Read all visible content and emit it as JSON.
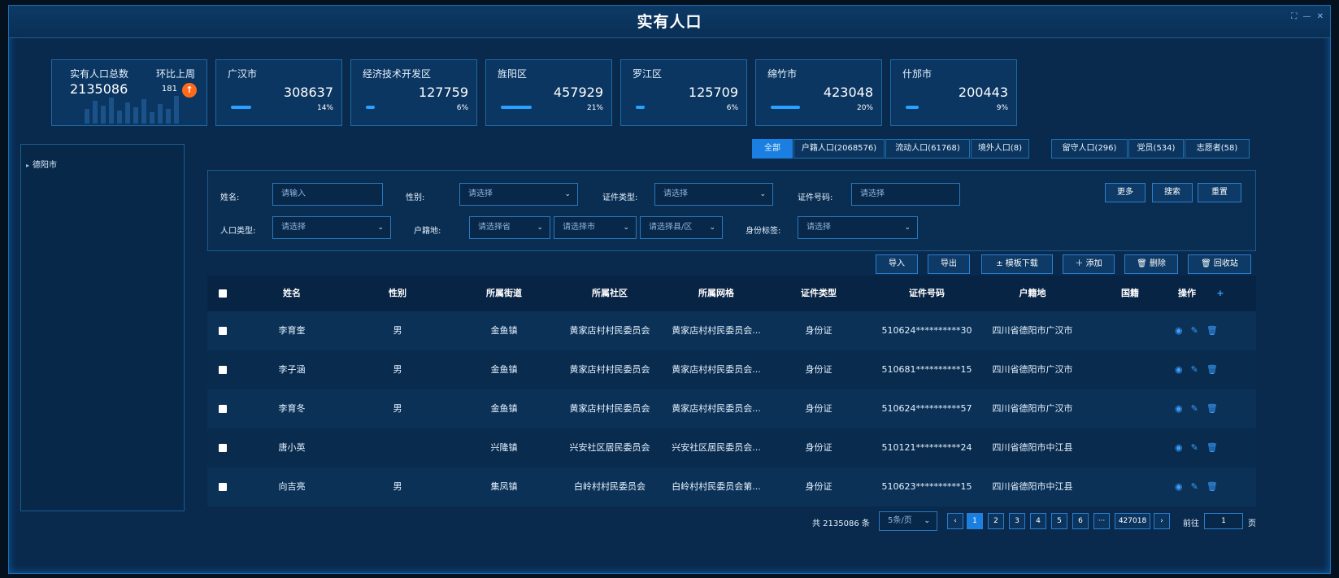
{
  "window": {
    "title": "实有人口",
    "controls": "⛶ — ✕"
  },
  "total": {
    "label": "实有人口总数",
    "ratio_label": "环比上周",
    "value": "2135086",
    "ratio_value": "181",
    "ratio_icon": "arrow-up-icon"
  },
  "regions": [
    {
      "name": "广汉市",
      "value": "308637",
      "pct": "14%",
      "fill": 0.14
    },
    {
      "name": "经济技术开发区",
      "value": "127759",
      "pct": "6%",
      "fill": 0.06
    },
    {
      "name": "旌阳区",
      "value": "457929",
      "pct": "21%",
      "fill": 0.21
    },
    {
      "name": "罗江区",
      "value": "125709",
      "pct": "6%",
      "fill": 0.06
    },
    {
      "name": "绵竹市",
      "value": "423048",
      "pct": "20%",
      "fill": 0.2
    },
    {
      "name": "什邡市",
      "value": "200443",
      "pct": "9%",
      "fill": 0.09
    }
  ],
  "tree": {
    "root": "德阳市"
  },
  "tabs": [
    "全部",
    "户籍人口(2068576)",
    "流动人口(61768)",
    "境外人口(8)",
    "留守人口(296)",
    "党员(534)",
    "志愿者(58)"
  ],
  "filters": {
    "name_label": "姓名:",
    "name_placeholder": "请输入",
    "gender_label": "性别:",
    "gender_value": "请选择",
    "idtype_label": "证件类型:",
    "idtype_value": "请选择",
    "idno_label": "证件号码:",
    "idno_placeholder": "请选择",
    "poptype_label": "人口类型:",
    "poptype_value": "请选择",
    "huji_label": "户籍地:",
    "province": "请选择省",
    "city": "请选择市",
    "county": "请选择县/区",
    "tag_label": "身份标签:",
    "tag_value": "请选择",
    "more": "更多",
    "search": "搜索",
    "reset": "重置"
  },
  "actions": {
    "import": "导入",
    "export": "导出",
    "template": "± 模板下载",
    "add": "＋ 添加",
    "delete": "🗑 删除",
    "recycle": "🗑 回收站"
  },
  "table": {
    "headers": [
      "姓名",
      "性别",
      "所属街道",
      "所属社区",
      "所属网格",
      "证件类型",
      "证件号码",
      "户籍地",
      "国籍",
      "操作"
    ],
    "rows": [
      {
        "name": "李育奎",
        "gender": "男",
        "street": "金鱼镇",
        "community": "黄家店村村民委员会",
        "grid": "黄家店村村民委员会...",
        "idtype": "身份证",
        "idno": "510624**********30",
        "huji": "四川省德阳市广汉市",
        "nation": ""
      },
      {
        "name": "李子涵",
        "gender": "男",
        "street": "金鱼镇",
        "community": "黄家店村村民委员会",
        "grid": "黄家店村村民委员会...",
        "idtype": "身份证",
        "idno": "510681**********15",
        "huji": "四川省德阳市广汉市",
        "nation": ""
      },
      {
        "name": "李育冬",
        "gender": "男",
        "street": "金鱼镇",
        "community": "黄家店村村民委员会",
        "grid": "黄家店村村民委员会...",
        "idtype": "身份证",
        "idno": "510624**********57",
        "huji": "四川省德阳市广汉市",
        "nation": ""
      },
      {
        "name": "唐小英",
        "gender": "",
        "street": "兴隆镇",
        "community": "兴安社区居民委员会",
        "grid": "兴安社区居民委员会...",
        "idtype": "身份证",
        "idno": "510121**********24",
        "huji": "四川省德阳市中江县",
        "nation": ""
      },
      {
        "name": "向吉亮",
        "gender": "男",
        "street": "集凤镇",
        "community": "白岭村村民委员会",
        "grid": "白岭村村民委员会第...",
        "idtype": "身份证",
        "idno": "510623**********15",
        "huji": "四川省德阳市中江县",
        "nation": ""
      }
    ]
  },
  "pager": {
    "total": "共 2135086 条",
    "size": "5条/页",
    "pages": [
      "1",
      "2",
      "3",
      "4",
      "5",
      "6",
      "···",
      "427018"
    ],
    "goto": "前往",
    "page": "1",
    "unit": "页"
  }
}
